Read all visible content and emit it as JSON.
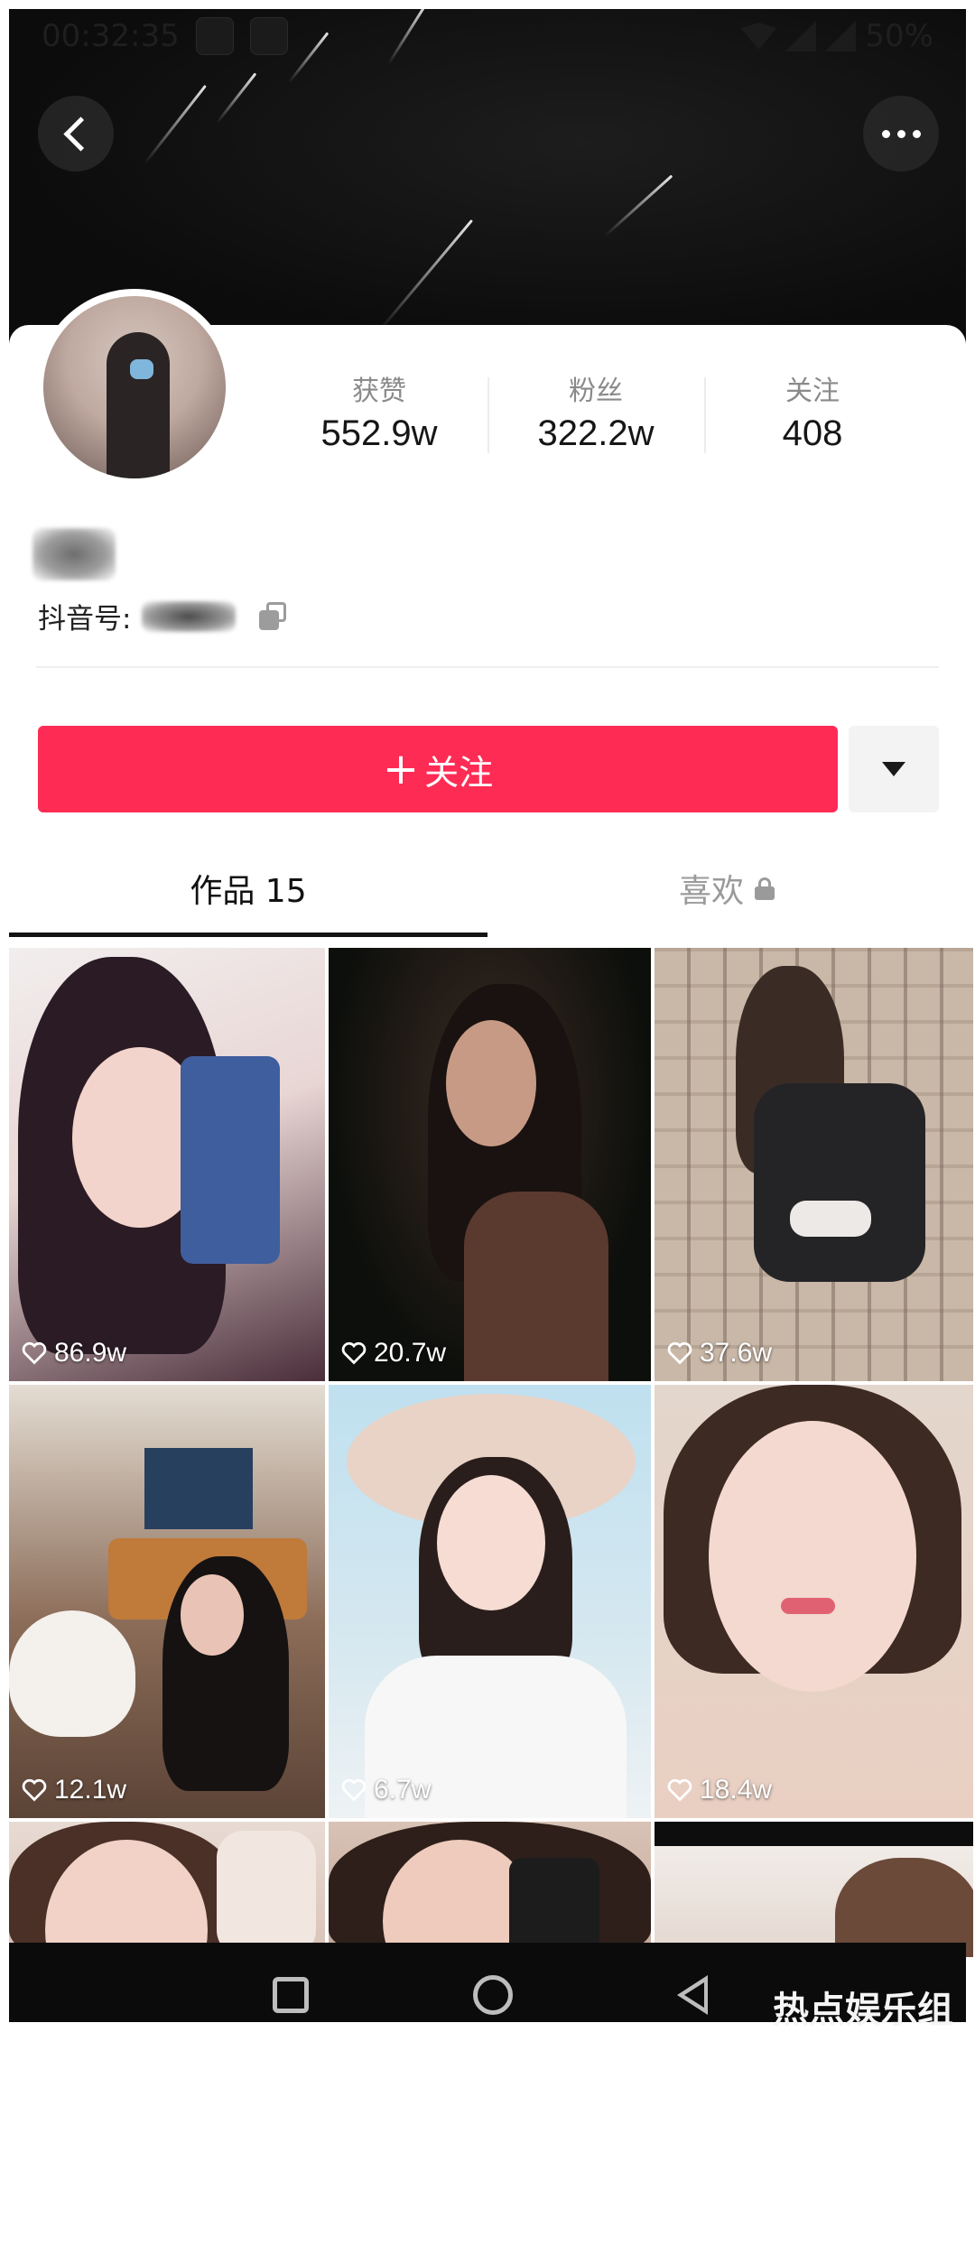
{
  "status_bar": {
    "time": "00:32:35",
    "battery": "50%"
  },
  "header": {
    "back_icon": "chevron-left-icon",
    "more_icon": "more-horizontal-icon"
  },
  "profile": {
    "stats": [
      {
        "label": "获赞",
        "value": "552.9w"
      },
      {
        "label": "粉丝",
        "value": "322.2w"
      },
      {
        "label": "关注",
        "value": "408"
      }
    ],
    "douyin_id_label": "抖音号:",
    "follow_button": {
      "icon": "+",
      "label": "关注"
    }
  },
  "tabs": [
    {
      "label": "作品 15",
      "active": true
    },
    {
      "label": "喜欢",
      "active": false,
      "locked": true
    }
  ],
  "videos": [
    {
      "likes": "86.9w"
    },
    {
      "likes": "20.7w"
    },
    {
      "likes": "37.6w"
    },
    {
      "likes": "12.1w"
    },
    {
      "likes": "6.7w"
    },
    {
      "likes": "18.4w"
    }
  ],
  "watermark": "热点娱乐组",
  "colors": {
    "accent": "#fe2c55",
    "text": "#161616",
    "muted": "#8a8a8a"
  }
}
